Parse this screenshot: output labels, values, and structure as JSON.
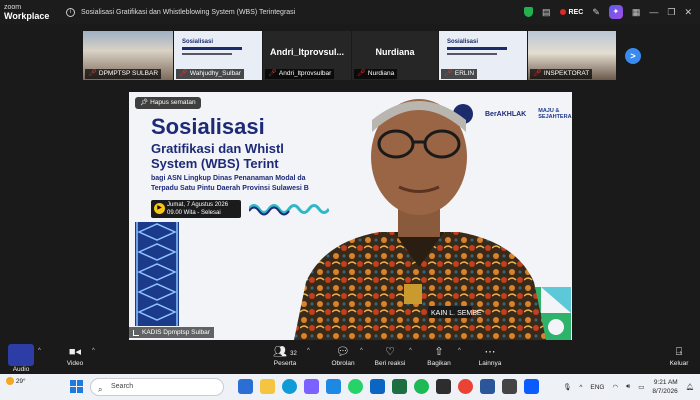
{
  "window": {
    "brand_line1": "zoom",
    "brand_line2": "Workplace",
    "title": "Sosialisasi Gratifikasi dan Whistleblowing System (WBS) Terintegrasi",
    "rec_label": "REC",
    "ai_label": "✦",
    "minimize": "—",
    "maximize": "❐",
    "close": "✕"
  },
  "participants": [
    {
      "name": "DPMPTSP SULBAR",
      "muted": true
    },
    {
      "name": "Wahjudhy_Sulbar",
      "muted": true
    },
    {
      "name": "Andri_ltprovsulbar",
      "display": "Andri_ltprovsul...",
      "muted": true
    },
    {
      "name": "Nurdiana",
      "display": "Nurdiana",
      "muted": true
    },
    {
      "name": "ERLIN",
      "muted": true
    },
    {
      "name": "INSPEKTORAT",
      "muted": true
    }
  ],
  "next_label": ">",
  "main_video": {
    "pin_label": "Hapus sematan",
    "speaker_name": "KADIS Dpmptsp Sulbar",
    "slide": {
      "title": "Sosialisasi",
      "subtitle_1": "Gratifikasi dan Whistl",
      "subtitle_2": "System (WBS) Terint",
      "desc_1": "bagi ASN Lingkup Dinas Penanaman Modal da",
      "desc_2": "Terpadu Satu Pintu Daerah Provinsi Sulawesi B",
      "date_1": "Jumat, 7 Agustus 2026",
      "date_2": "09.00 Wita - Selesai",
      "logo_berakhlak": "BerAKHLAK",
      "logo_maju_1": "MAJU &",
      "logo_maju_2": "SEJAHTERA"
    },
    "badge_text": "KAIN L. SEMBE"
  },
  "controls": {
    "audio": "Audio",
    "video": "Video",
    "participants": "Peserta",
    "participant_count": "32",
    "chat": "Obrolan",
    "react": "Beri reaksi",
    "share": "Bagikan",
    "more": "Lainnya",
    "leave": "Keluar"
  },
  "taskbar": {
    "temperature": "29°",
    "search_placeholder": "Search",
    "language": "ENG",
    "time": "9:21 AM",
    "date": "8/7/2026"
  },
  "colors": {
    "accent": "#3a8bf0",
    "rec": "#e02828",
    "slide_navy": "#1d2a78",
    "shield": "#22b14c"
  }
}
